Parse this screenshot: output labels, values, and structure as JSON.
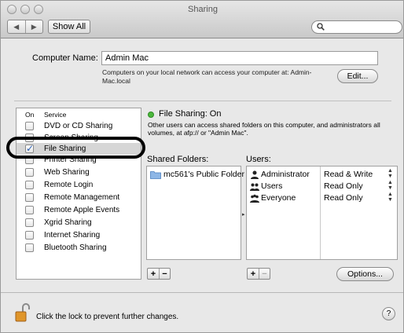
{
  "window": {
    "title": "Sharing"
  },
  "toolbar": {
    "back_glyph": "◀",
    "forward_glyph": "▶",
    "show_all_label": "Show All",
    "search_value": ""
  },
  "computer_name": {
    "label": "Computer Name:",
    "value": "Admin Mac",
    "description": "Computers on your local network can access your computer at: Admin-Mac.local",
    "edit_label": "Edit..."
  },
  "services": {
    "header_on": "On",
    "header_service": "Service",
    "items": [
      {
        "label": "DVD or CD Sharing",
        "checked": false
      },
      {
        "label": "Screen Sharing",
        "checked": false
      },
      {
        "label": "File Sharing",
        "checked": true
      },
      {
        "label": "Printer Sharing",
        "checked": false
      },
      {
        "label": "Web Sharing",
        "checked": false
      },
      {
        "label": "Remote Login",
        "checked": false
      },
      {
        "label": "Remote Management",
        "checked": false
      },
      {
        "label": "Remote Apple Events",
        "checked": false
      },
      {
        "label": "Xgrid Sharing",
        "checked": false
      },
      {
        "label": "Internet Sharing",
        "checked": false
      },
      {
        "label": "Bluetooth Sharing",
        "checked": false
      }
    ]
  },
  "status": {
    "title": "File Sharing: On",
    "description": "Other users can access shared folders on this computer, and administrators all volumes, at afp:// or \"Admin Mac\".",
    "color": "#4cb83c"
  },
  "shared_folders": {
    "label": "Shared Folders:",
    "items": [
      "mc561's Public Folder"
    ]
  },
  "users": {
    "label": "Users:",
    "items": [
      {
        "name": "Administrator",
        "permission": "Read & Write",
        "icon": "single-user-icon"
      },
      {
        "name": "Users",
        "permission": "Read Only",
        "icon": "group-icon"
      },
      {
        "name": "Everyone",
        "permission": "Read Only",
        "icon": "group-icon"
      }
    ]
  },
  "buttons": {
    "plus": "+",
    "minus": "−",
    "options_label": "Options..."
  },
  "footer": {
    "lock_text": "Click the lock to prevent further changes.",
    "help_label": "?"
  }
}
